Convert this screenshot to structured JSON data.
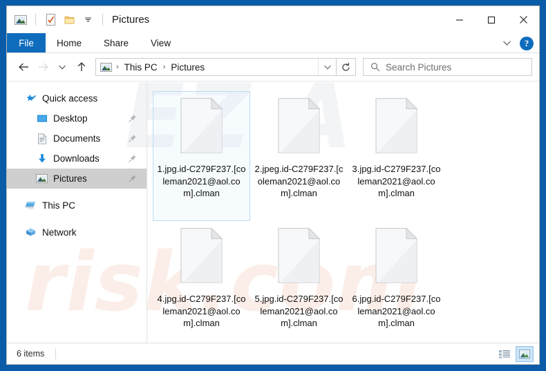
{
  "window": {
    "title": "Pictures",
    "quick_access_icons": [
      "pictures-folder-icon",
      "properties-icon",
      "new-folder-icon",
      "customize-dropdown-icon"
    ],
    "controls": {
      "minimize": "minimize-icon",
      "maximize": "maximize-icon",
      "close": "close-icon"
    }
  },
  "ribbon": {
    "tabs": [
      {
        "label": "File"
      },
      {
        "label": "Home"
      },
      {
        "label": "Share"
      },
      {
        "label": "View"
      }
    ],
    "expand_icon": "chevron-down-icon",
    "help_label": "?"
  },
  "address": {
    "back_icon": "arrow-left-icon",
    "forward_icon": "arrow-right-icon",
    "recent_icon": "chevron-down-icon",
    "up_icon": "arrow-up-icon",
    "breadcrumb": [
      "This PC",
      "Pictures"
    ],
    "separator": "›",
    "dropdown_icon": "chevron-down-icon",
    "refresh_icon": "refresh-icon"
  },
  "search": {
    "placeholder": "Search Pictures",
    "value": "",
    "icon": "search-icon"
  },
  "sidebar": {
    "groups": [
      {
        "header": {
          "label": "Quick access",
          "icon": "star-pin-icon",
          "selected": false,
          "pinned": false
        },
        "items": [
          {
            "label": "Desktop",
            "icon": "desktop-icon",
            "selected": false,
            "pinned": true
          },
          {
            "label": "Documents",
            "icon": "documents-icon",
            "selected": false,
            "pinned": true
          },
          {
            "label": "Downloads",
            "icon": "downloads-icon",
            "selected": false,
            "pinned": true
          },
          {
            "label": "Pictures",
            "icon": "pictures-icon",
            "selected": true,
            "pinned": true
          }
        ]
      },
      {
        "header": {
          "label": "This PC",
          "icon": "this-pc-icon",
          "selected": false,
          "pinned": false
        },
        "items": []
      },
      {
        "header": {
          "label": "Network",
          "icon": "network-icon",
          "selected": false,
          "pinned": false
        },
        "items": []
      }
    ]
  },
  "files": [
    {
      "name": "1.jpg.id-C279F237.[coleman2021@aol.com].clman",
      "icon": "blank-file-icon",
      "selected": true
    },
    {
      "name": "2.jpeg.id-C279F237.[coleman2021@aol.com].clman",
      "icon": "blank-file-icon",
      "selected": false
    },
    {
      "name": "3.jpg.id-C279F237.[coleman2021@aol.com].clman",
      "icon": "blank-file-icon",
      "selected": false
    },
    {
      "name": "4.jpg.id-C279F237.[coleman2021@aol.com].clman",
      "icon": "blank-file-icon",
      "selected": false
    },
    {
      "name": "5.jpg.id-C279F237.[coleman2021@aol.com].clman",
      "icon": "blank-file-icon",
      "selected": false
    },
    {
      "name": "6.jpg.id-C279F237.[coleman2021@aol.com].clman",
      "icon": "blank-file-icon",
      "selected": false
    }
  ],
  "status": {
    "item_count": "6 items",
    "view_buttons": [
      {
        "name": "details-view",
        "icon": "details-view-icon",
        "active": false
      },
      {
        "name": "large-icons-view",
        "icon": "large-icons-view-icon",
        "active": true
      }
    ]
  },
  "watermarks": {
    "top": "EZ A",
    "bottom": "risk.com"
  },
  "colors": {
    "desktop": "#0b5ca8",
    "accent": "#0f6cbd",
    "selection": "#cfcfcf",
    "file_selection_border": "#bcdcf4"
  }
}
